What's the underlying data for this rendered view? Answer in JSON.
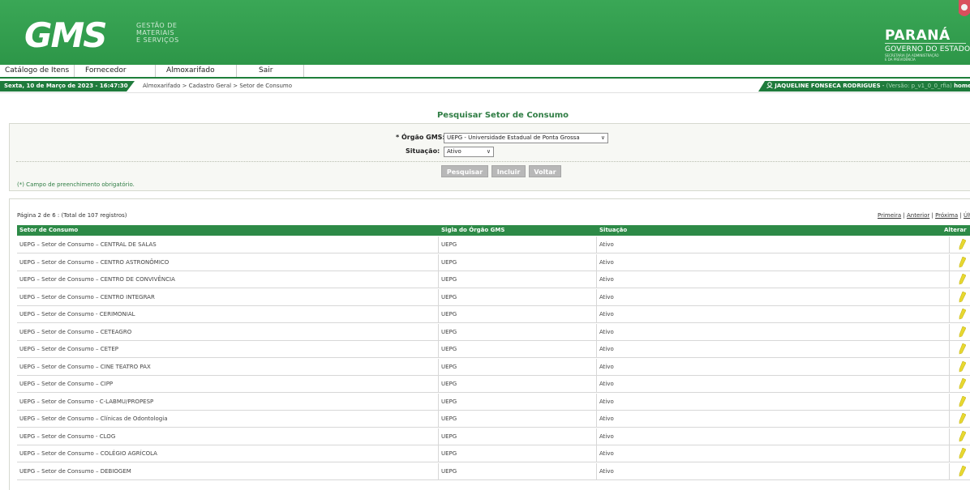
{
  "header": {
    "logo_text": "GMS",
    "subtitle_lines": [
      "GESTÃO DE",
      "MATERIAIS",
      "E SERVIÇOS"
    ],
    "gov_title": "PARANÁ",
    "gov_subtitle": "GOVERNO DO ESTADO",
    "gov_secretariat_lines": [
      "SECRETARIA DA ADMINISTRAÇÃO",
      "E DA PREVIDÊNCIA"
    ]
  },
  "menu": {
    "items": [
      "Catálogo de Itens",
      "Fornecedor",
      "Almoxarifado",
      "Sair"
    ]
  },
  "status": {
    "date": "Sexta, 10 de Março de 2023 - 16:47:30",
    "breadcrumb": "Almoxarifado > Cadastro Geral > Setor de Consumo",
    "user": "JAQUELINE FONSECA RODRIGUES",
    "version": "(Versão: p_v1_0_0_rfia)",
    "home": "home"
  },
  "page": {
    "title": "Pesquisar Setor de Consumo"
  },
  "search": {
    "orgao_label": "* Órgão GMS:",
    "orgao_value": "UEPG - Universidade Estadual de Ponta Grossa",
    "situacao_label": "Situação:",
    "situacao_value": "Ativo",
    "buttons": {
      "search": "Pesquisar",
      "include": "Incluir",
      "back": "Voltar"
    },
    "required_note": "(*) Campo de preenchimento obrigatório."
  },
  "results": {
    "page_info": "Página 2 de 6 : (Total de 107 registros)",
    "nav": {
      "first": "Primeira",
      "prev": "Anterior",
      "next": "Próxima",
      "last": "Últ"
    },
    "columns": [
      "Setor de Consumo",
      "Sigla do Órgão GMS",
      "Situação",
      "Alterar"
    ],
    "rows": [
      [
        "UEPG – Setor de Consumo – CENTRAL DE SALAS",
        "UEPG",
        "Ativo"
      ],
      [
        "UEPG – Setor de Consumo – CENTRO ASTRONÔMICO",
        "UEPG",
        "Ativo"
      ],
      [
        "UEPG – Setor de Consumo – CENTRO DE CONVIVÊNCIA",
        "UEPG",
        "Ativo"
      ],
      [
        "UEPG – Setor de Consumo – CENTRO INTEGRAR",
        "UEPG",
        "Ativo"
      ],
      [
        "UEPG – Setor de Consumo - CERIMONIAL",
        "UEPG",
        "Ativo"
      ],
      [
        "UEPG – Setor de Consumo – CETEAGRO",
        "UEPG",
        "Ativo"
      ],
      [
        "UEPG – Setor de Consumo – CETEP",
        "UEPG",
        "Ativo"
      ],
      [
        "UEPG – Setor de Consumo – CINE TEATRO PAX",
        "UEPG",
        "Ativo"
      ],
      [
        "UEPG – Setor de Consumo – CIPP",
        "UEPG",
        "Ativo"
      ],
      [
        "UEPG – Setor de Consumo - C-LABMU/PROPESP",
        "UEPG",
        "Ativo"
      ],
      [
        "UEPG – Setor de Consumo – Clínicas de Odontologia",
        "UEPG",
        "Ativo"
      ],
      [
        "UEPG – Setor de Consumo - CLOG",
        "UEPG",
        "Ativo"
      ],
      [
        "UEPG – Setor de Consumo – COLÉGIO AGRÍCOLA",
        "UEPG",
        "Ativo"
      ],
      [
        "UEPG – Setor de Consumo – DEBIOGEM",
        "UEPG",
        "Ativo"
      ]
    ]
  },
  "colors": {
    "header_green": "#2e9d4b",
    "dark_green": "#1f7b3c",
    "table_header": "#2d8a47",
    "title_green": "#2f7d44",
    "pencil": "#e8d830"
  },
  "icons": {
    "user": "user-icon",
    "edit": "pencil-icon",
    "crest": "parana-crest-icon"
  }
}
